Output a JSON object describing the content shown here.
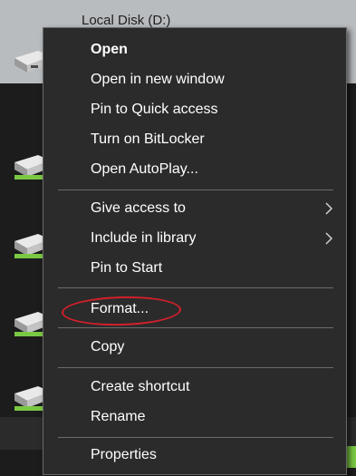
{
  "explorer": {
    "selected_drive_label": "Local Disk (D:)",
    "drive_icon": "hard-drive-icon",
    "accent_color": "#7ac943"
  },
  "context_menu": {
    "items": [
      {
        "label": "Open",
        "bold": true
      },
      {
        "label": "Open in new window"
      },
      {
        "label": "Pin to Quick access"
      },
      {
        "label": "Turn on BitLocker"
      },
      {
        "label": "Open AutoPlay..."
      },
      {
        "label": "Give access to",
        "submenu": true
      },
      {
        "label": "Include in library",
        "submenu": true
      },
      {
        "label": "Pin to Start"
      },
      {
        "label": "Format...",
        "highlighted": true
      },
      {
        "label": "Copy"
      },
      {
        "label": "Create shortcut"
      },
      {
        "label": "Rename"
      },
      {
        "label": "Properties"
      }
    ],
    "highlight_color": "#d2202b",
    "submenu_icon": "chevron-right-icon"
  }
}
